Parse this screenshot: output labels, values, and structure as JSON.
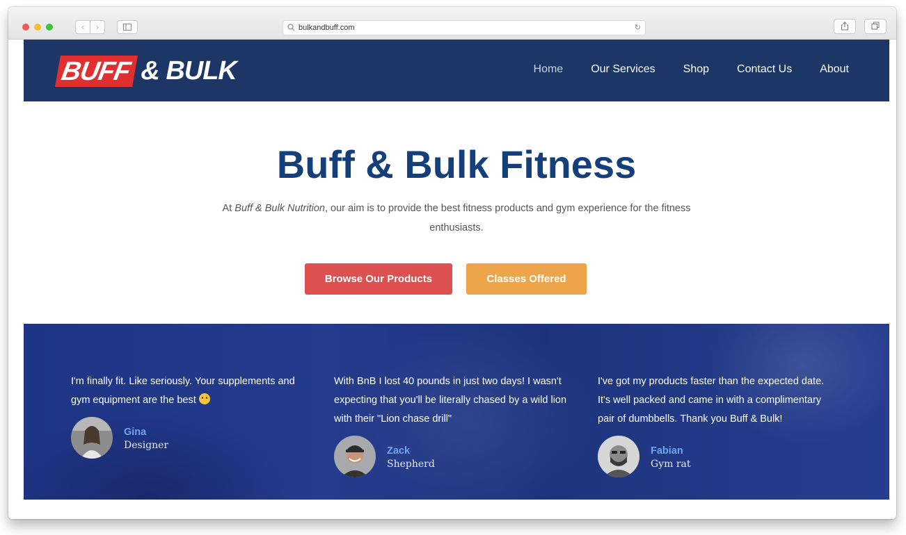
{
  "browser": {
    "url": "bulkandbuff.com",
    "back_icon": "chevron-left-icon",
    "forward_icon": "chevron-right-icon"
  },
  "site": {
    "logo": {
      "part1": "BUFF",
      "part2": "& BULK"
    },
    "nav": {
      "items": [
        {
          "label": "Home"
        },
        {
          "label": "Our Services"
        },
        {
          "label": "Shop"
        },
        {
          "label": "Contact Us"
        },
        {
          "label": "About"
        }
      ]
    },
    "hero": {
      "title": "Buff & Bulk Fitness",
      "intro_prefix": "At ",
      "intro_emphasis": "Buff & Bulk Nutrition",
      "intro_suffix": ", our aim is to provide the best fitness products and gym experience for the fitness enthusiasts.",
      "primary_button": "Browse Our Products",
      "secondary_button": "Classes Offered"
    },
    "testimonials": [
      {
        "quote": "I'm finally fit. Like seriously. Your supplements and gym equipment are the best",
        "emoji": "smiling-face-icon",
        "name": "Gina",
        "role": "Designer"
      },
      {
        "quote": "With BnB I lost 40 pounds in just two days! I wasn't expecting that you'll be literally chased by a wild lion with their \"Lion chase drill\"",
        "name": "Zack",
        "role": "Shepherd"
      },
      {
        "quote": "I've got my products faster than the expected date. It's well packed and came in with a complimentary pair of dumbbells. Thank you Buff & Bulk!",
        "name": "Fabian",
        "role": "Gym rat"
      }
    ]
  },
  "colors": {
    "navbar": "#1c3766",
    "title": "#153f7a",
    "primary_button": "#dc5050",
    "secondary_button": "#eea54a",
    "testimonial_name": "#6fa6ef"
  }
}
